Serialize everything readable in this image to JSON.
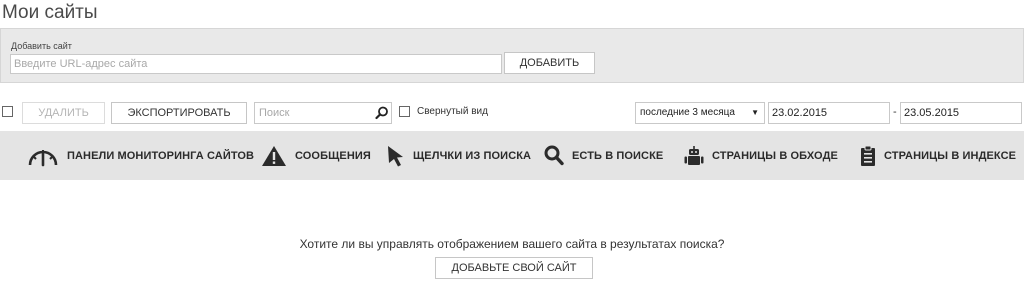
{
  "page": {
    "title": "Мои сайты"
  },
  "add_site": {
    "label": "Добавить сайт",
    "url_placeholder": "Введите URL-адрес сайта",
    "url_value": "",
    "add_button": "ДОБАВИТЬ"
  },
  "toolbar": {
    "delete_button": "УДАЛИТЬ",
    "export_button": "ЭКСПОРТИРОВАТЬ",
    "search_placeholder": "Поиск",
    "search_icon": "search-icon",
    "collapsed_view_label": "Свернутый вид",
    "period_select": "последние 3 месяца",
    "date_from": "23.02.2015",
    "date_separator": "-",
    "date_to": "23.05.2015"
  },
  "nav": {
    "items": [
      {
        "label": "ПАНЕЛИ МОНИТОРИНГА САЙТОВ",
        "icon": "gauge-icon"
      },
      {
        "label": "СООБЩЕНИЯ",
        "icon": "warning-icon"
      },
      {
        "label": "ЩЕЛЧКИ ИЗ ПОИСКА",
        "icon": "cursor-icon"
      },
      {
        "label": "ЕСТЬ В ПОИСКЕ",
        "icon": "search-icon"
      },
      {
        "label": "СТРАНИЦЫ В ОБХОДЕ",
        "icon": "robot-icon"
      },
      {
        "label": "СТРАНИЦЫ В ИНДЕКСЕ",
        "icon": "clipboard-icon"
      }
    ]
  },
  "empty_state": {
    "prompt": "Хотите ли вы управлять отображением вашего сайта в результатах поиска?",
    "add_site_button": "ДОБАВЬТЕ СВОЙ САЙТ"
  },
  "colors": {
    "panel_bg": "#e9e9e9",
    "nav_bg": "#e4e4e4",
    "text": "#333333"
  }
}
